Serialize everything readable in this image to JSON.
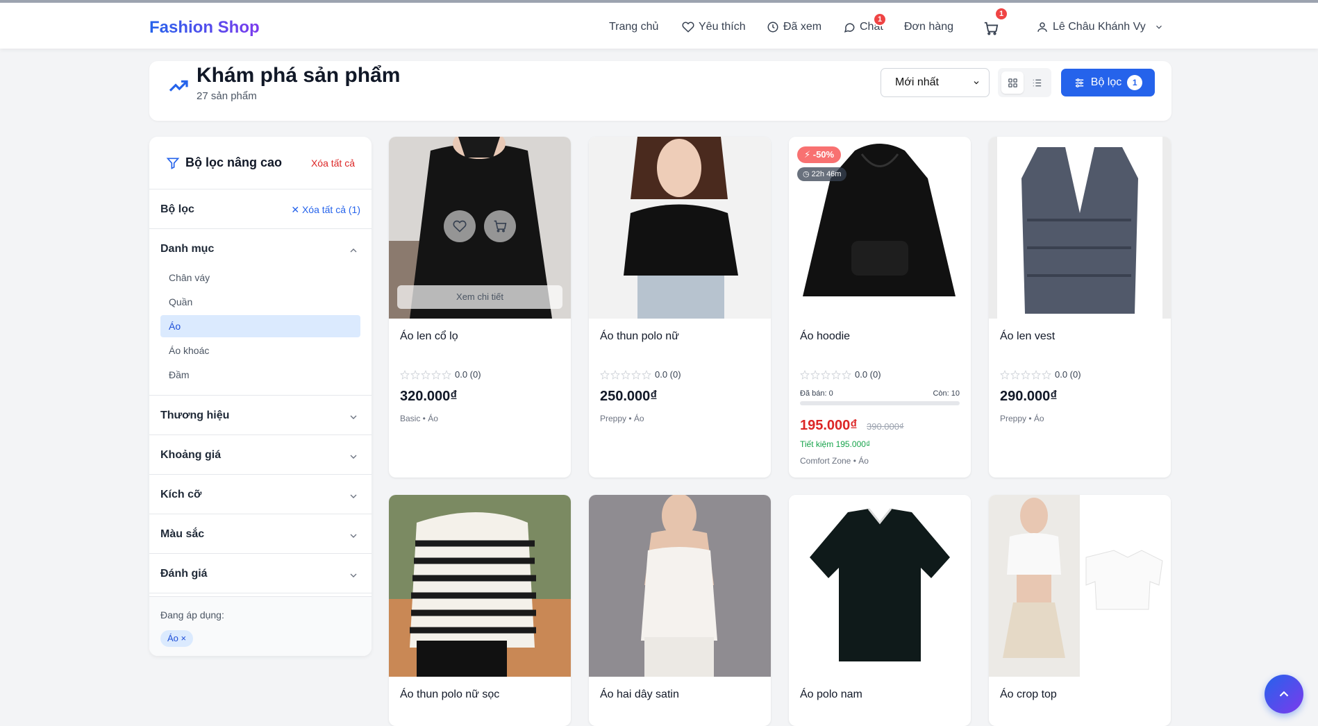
{
  "brand": "Fashion Shop",
  "nav": {
    "home": "Trang chủ",
    "wishlist": "Yêu thích",
    "viewed": "Đã xem",
    "chat": "Chat",
    "chat_badge": "1",
    "orders": "Đơn hàng",
    "cart_badge": "1",
    "user": "Lê Châu Khánh Vy"
  },
  "header": {
    "title": "Khám phá sản phẩm",
    "count": "27 sản phẩm",
    "sort_selected": "Mới nhất",
    "filter_label": "Bộ lọc",
    "filter_count": "1"
  },
  "sidebar": {
    "title": "Bộ lọc nâng cao",
    "clear_all": "Xóa tất cả",
    "filter_label": "Bộ lọc",
    "filter_clear": "Xóa tất cả (1)",
    "category": {
      "label": "Danh mục",
      "items": [
        "Chân váy",
        "Quần",
        "Áo",
        "Áo khoác",
        "Đầm"
      ],
      "active_index": 2
    },
    "sections": [
      "Thương hiệu",
      "Khoảng giá",
      "Kích cỡ",
      "Màu sắc",
      "Đánh giá"
    ],
    "applied_label": "Đang áp dụng:",
    "applied_chip": "Áo ×"
  },
  "products": [
    {
      "name": "Áo len cổ lọ",
      "rating": "0.0 (0)",
      "price": "320.000₫",
      "meta": "Basic • Áo",
      "hover_label": "Xem chi tiết"
    },
    {
      "name": "Áo thun polo nữ",
      "rating": "0.0 (0)",
      "price": "250.000₫",
      "meta": "Preppy • Áo"
    },
    {
      "name": "Áo hoodie",
      "rating": "0.0 (0)",
      "price": "195.000₫",
      "old_price": "390.000₫",
      "discount": "-50%",
      "timer": "22h 46m",
      "sold": "Đã bán: 0",
      "remaining": "Còn: 10",
      "sold_fraction": 0,
      "saving": "Tiết kiệm 195.000₫",
      "meta": "Comfort Zone • Áo"
    },
    {
      "name": "Áo len vest",
      "rating": "0.0 (0)",
      "price": "290.000₫",
      "meta": "Preppy • Áo"
    },
    {
      "name": "Áo thun polo nữ sọc"
    },
    {
      "name": "Áo hai dây satin"
    },
    {
      "name": "Áo polo nam"
    },
    {
      "name": "Áo crop top"
    }
  ],
  "colors": {
    "primary": "#2563eb",
    "danger": "#dc2626",
    "success": "#16a34a"
  }
}
